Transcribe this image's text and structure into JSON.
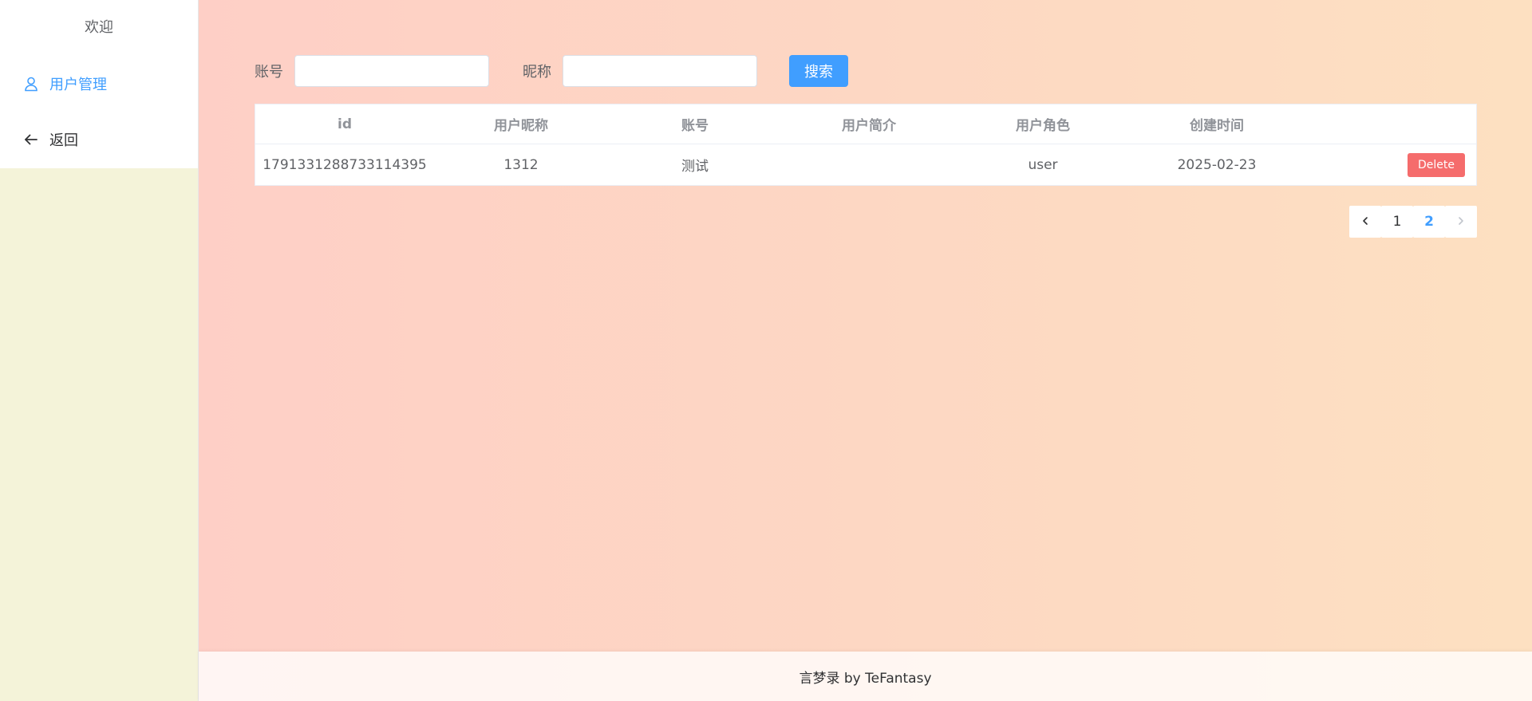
{
  "sidebar": {
    "welcome": "欢迎",
    "items": [
      {
        "label": "用户管理",
        "icon": "user-icon",
        "active": true
      },
      {
        "label": "返回",
        "icon": "arrow-left-icon",
        "active": false
      }
    ]
  },
  "search": {
    "account_label": "账号",
    "account_value": "",
    "nickname_label": "昵称",
    "nickname_value": "",
    "button_label": "搜索"
  },
  "table": {
    "headers": [
      "id",
      "用户昵称",
      "账号",
      "用户简介",
      "用户角色",
      "创建时间"
    ],
    "rows": [
      {
        "id": "1791331288733114395",
        "nickname": "1312",
        "account": "测试",
        "profile": "",
        "role": "user",
        "created": "2025-02-23",
        "action": "Delete"
      }
    ]
  },
  "pagination": {
    "prev_icon": "chevron-left-icon",
    "pages": [
      "1",
      "2"
    ],
    "current": "2",
    "next_icon": "chevron-right-icon"
  },
  "footer": {
    "text": "言梦录 by TeFantasy"
  },
  "colors": {
    "accent": "#409eff",
    "danger": "#f56c6c",
    "sidebar_bg": "#f4f3d9"
  }
}
